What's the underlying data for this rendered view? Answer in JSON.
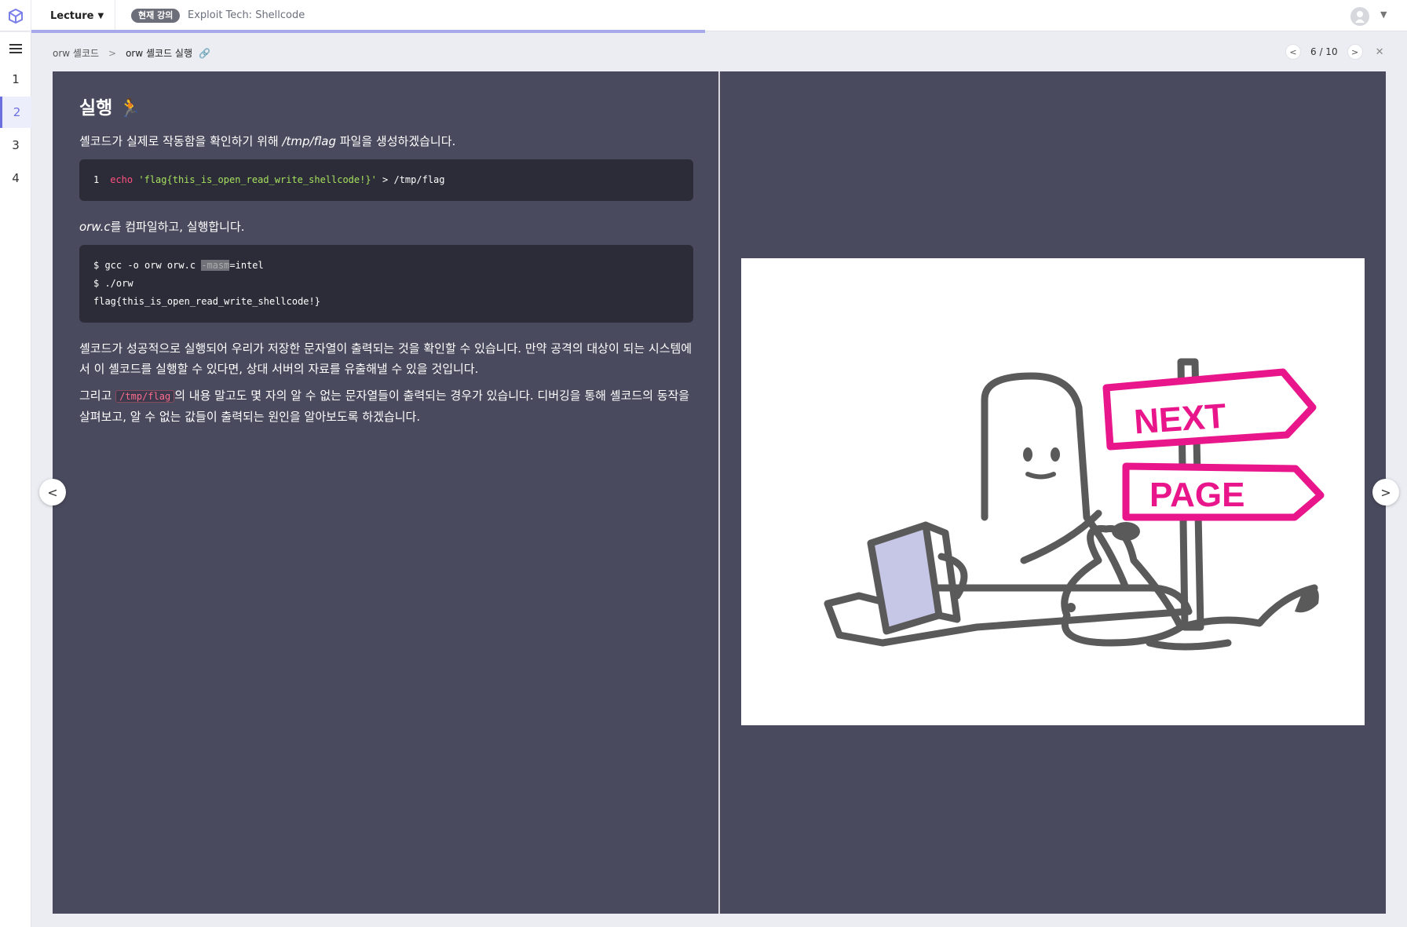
{
  "header": {
    "lecture_label": "Lecture",
    "current_badge": "현재 강의",
    "current_title": "Exploit Tech: Shellcode",
    "progress_fraction": 0.49
  },
  "sidebar": {
    "steps": [
      "1",
      "2",
      "3",
      "4"
    ],
    "active_step": "2"
  },
  "breadcrumb": {
    "parent": "orw 셸코드",
    "current": "orw 셸코드 실행"
  },
  "pager": {
    "label": "6 / 10"
  },
  "slide": {
    "heading": "실행",
    "heading_emoji": "🏃",
    "p1_before": "셸코드가 실제로 작동함을 확인하기 위해 ",
    "p1_path": "/tmp/flag",
    "p1_after": " 파일을 생성하겠습니다.",
    "code1": {
      "line_no": "1",
      "cmd": "echo",
      "arg": "'flag{this_is_open_read_write_shellcode!}'",
      "rest": " > /tmp/flag"
    },
    "p2_file": "orw.c",
    "p2_rest": "를 컴파일하고, 실행합니다.",
    "code2": {
      "line1_a": "$ gcc -o orw orw.c ",
      "line1_hl": "-masm",
      "line1_b": "=intel",
      "line2": "$ ./orw",
      "line3": "flag{this_is_open_read_write_shellcode!}"
    },
    "p3": "셸코드가 성공적으로 실행되어 우리가 저장한 문자열이 출력되는 것을 확인할 수 있습니다. 만약 공격의 대상이 되는 시스템에서 이 셸코드를 실행할 수 있다면, 상대 서버의 자료를 유출해낼 수 있을 것입니다.",
    "p4_before": "그리고 ",
    "p4_code": "/tmp/flag",
    "p4_after": "의 내용 말고도 몇 자의 알 수 없는 문자열들이 출력되는 경우가 있습니다. 디버깅을 통해 셸코드의 동작을 살펴보고, 알 수 없는 값들이 출력되는 원인을 알아보도록 하겠습니다."
  },
  "illustration": {
    "sign_top": "NEXT",
    "sign_bottom": "PAGE",
    "accent_color": "#e8168a",
    "line_color": "#5a5a5a",
    "book_color": "#c6c6e6"
  }
}
